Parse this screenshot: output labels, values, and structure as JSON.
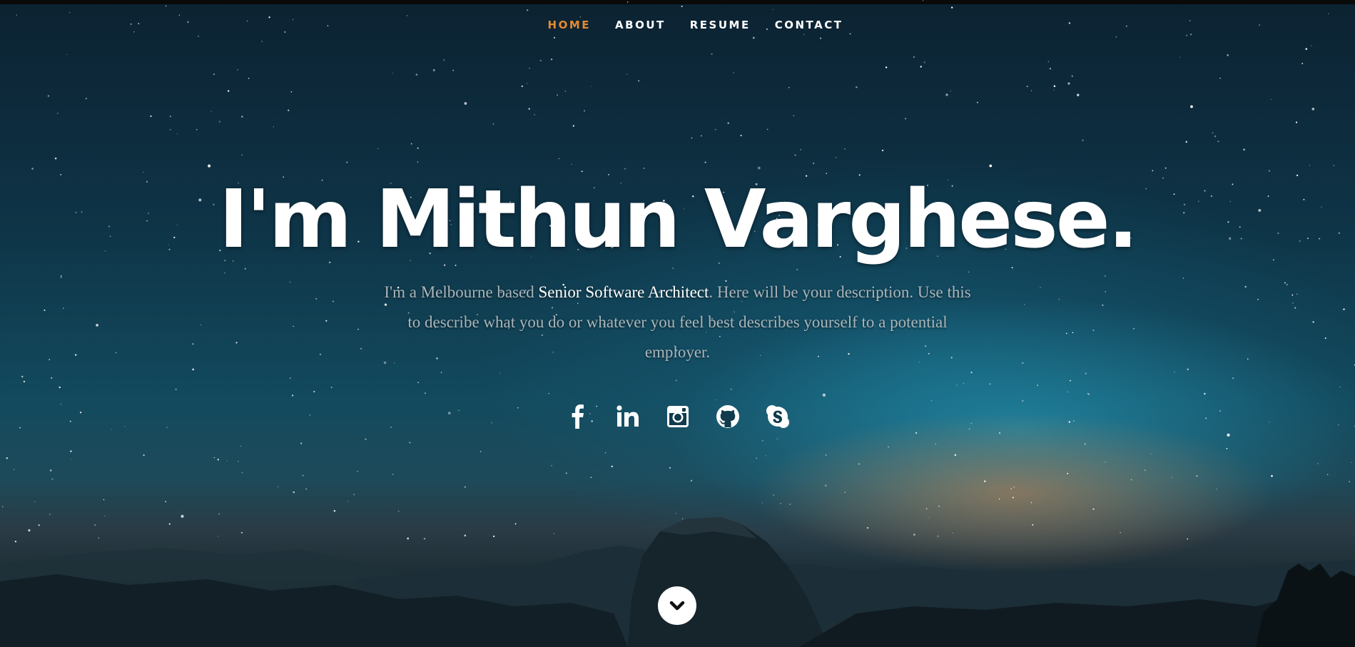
{
  "nav": {
    "items": [
      {
        "label": "HOME",
        "active": true
      },
      {
        "label": "ABOUT",
        "active": false
      },
      {
        "label": "RESUME",
        "active": false
      },
      {
        "label": "CONTACT",
        "active": false
      }
    ],
    "active_color": "#e58a30"
  },
  "hero": {
    "headline": "I'm Mithun Varghese.",
    "description_prefix": "I'm a Melbourne based ",
    "description_role": "Senior Software Architect",
    "description_suffix": ". Here will be your description. Use this to describe what you do or whatever you feel best describes yourself to a potential employer."
  },
  "social": [
    {
      "icon": "facebook-icon"
    },
    {
      "icon": "linkedin-icon"
    },
    {
      "icon": "instagram-icon"
    },
    {
      "icon": "github-icon"
    },
    {
      "icon": "skype-icon"
    }
  ],
  "scroll": {
    "icon": "chevron-down-icon"
  }
}
